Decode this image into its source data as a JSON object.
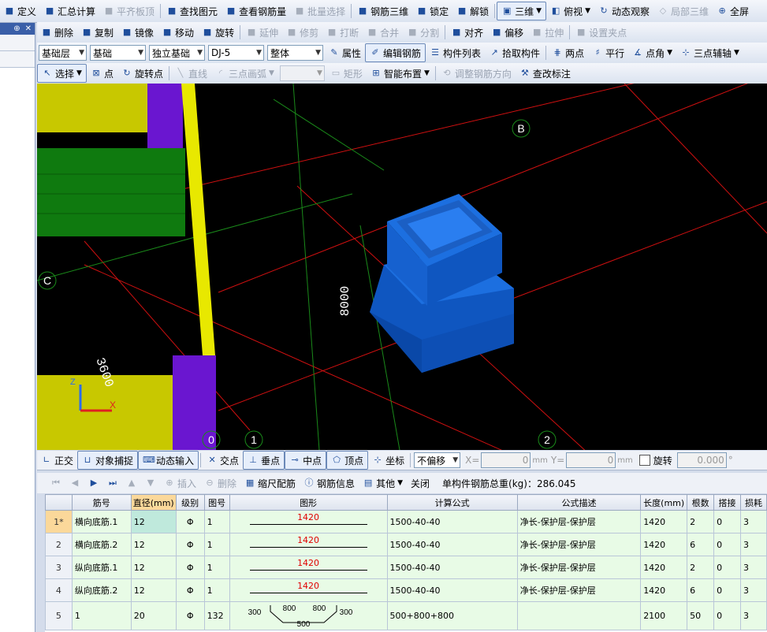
{
  "toolbar1": {
    "items": [
      {
        "label": "定义",
        "icon": "define-icon",
        "disabled": false
      },
      {
        "label": "汇总计算",
        "icon": "sigma-icon",
        "disabled": false
      },
      {
        "label": "平齐板顶",
        "icon": "align-slab-icon",
        "disabled": true
      },
      {
        "label": "查找图元",
        "icon": "find-element-icon",
        "disabled": false
      },
      {
        "label": "查看钢筋量",
        "icon": "rebar-quantity-icon",
        "disabled": false
      },
      {
        "label": "批量选择",
        "icon": "batch-select-icon",
        "disabled": true
      },
      {
        "label": "钢筋三维",
        "icon": "rebar-3d-icon",
        "disabled": false
      },
      {
        "label": "锁定",
        "icon": "lock-icon",
        "disabled": false
      },
      {
        "label": "解锁",
        "icon": "unlock-icon",
        "disabled": false
      }
    ],
    "view3d_label": "三维",
    "topview_label": "俯视",
    "dynamic_view_label": "动态观察",
    "local3d_label": "局部三维",
    "fullscreen_label": "全屏"
  },
  "toolbar2": {
    "items": [
      {
        "label": "删除",
        "icon": "delete-icon",
        "disabled": false
      },
      {
        "label": "复制",
        "icon": "copy-icon",
        "disabled": false
      },
      {
        "label": "镜像",
        "icon": "mirror-icon",
        "disabled": false
      },
      {
        "label": "移动",
        "icon": "move-icon",
        "disabled": false
      },
      {
        "label": "旋转",
        "icon": "rotate-icon",
        "disabled": false
      },
      {
        "label": "延伸",
        "icon": "extend-icon",
        "disabled": true
      },
      {
        "label": "修剪",
        "icon": "trim-icon",
        "disabled": true
      },
      {
        "label": "打断",
        "icon": "break-icon",
        "disabled": true
      },
      {
        "label": "合并",
        "icon": "merge-icon",
        "disabled": true
      },
      {
        "label": "分割",
        "icon": "split-icon",
        "disabled": true
      },
      {
        "label": "对齐",
        "icon": "align-icon",
        "disabled": false
      },
      {
        "label": "偏移",
        "icon": "offset-icon",
        "disabled": false
      },
      {
        "label": "拉伸",
        "icon": "stretch-icon",
        "disabled": true
      },
      {
        "label": "设置夹点",
        "icon": "grip-icon",
        "disabled": true
      }
    ]
  },
  "toolbar3": {
    "floor": "基础层",
    "category": "基础",
    "type": "独立基础",
    "component": "DJ-5",
    "whole": "整体",
    "properties_label": "属性",
    "edit_rebar_label": "编辑钢筋",
    "component_list_label": "构件列表",
    "pick_component_label": "拾取构件",
    "two_points_label": "两点",
    "parallel_label": "平行",
    "point_angle_label": "点角",
    "three_point_aux_label": "三点辅轴"
  },
  "toolbar4": {
    "select_label": "选择",
    "point_label": "点",
    "rotate_point_label": "旋转点",
    "line_label": "直线",
    "arc_label": "三点画弧",
    "rect_label": "矩形",
    "smart_layout_label": "智能布置",
    "adjust_rebar_dir_label": "调整钢筋方向",
    "check_annotation_label": "查改标注"
  },
  "viewport": {
    "axis_labels": [
      "B",
      "C",
      "1",
      "2",
      "0"
    ],
    "dimension_8000": "8000",
    "dimension_3600": "3600",
    "axis_x": "X",
    "axis_z": "Z"
  },
  "snapbar": {
    "ortho_label": "正交",
    "object_snap_label": "对象捕捉",
    "dynamic_input_label": "动态输入",
    "intersection_label": "交点",
    "perpendicular_label": "垂点",
    "midpoint_label": "中点",
    "vertex_label": "顶点",
    "coordinate_label": "坐标",
    "offset_mode": "不偏移",
    "x_label": "X=",
    "x_value": "0",
    "y_label": "Y=",
    "y_value": "0",
    "unit": "mm",
    "rotate_label": "旋转",
    "rotate_value": "0.000",
    "degree": "°"
  },
  "gridtools": {
    "insert_label": "插入",
    "delete_label": "删除",
    "scale_rebar_label": "缩尺配筋",
    "rebar_info_label": "钢筋信息",
    "other_label": "其他",
    "close_label": "关闭",
    "total_label": "单构件钢筋总重(kg)：286.045"
  },
  "table": {
    "headers": [
      "筋号",
      "直径(mm)",
      "级别",
      "图号",
      "图形",
      "计算公式",
      "公式描述",
      "长度(mm)",
      "根数",
      "搭接",
      "损耗"
    ],
    "rows": [
      {
        "num": "1*",
        "name": "横向底筋.1",
        "dia": "12",
        "grade": "Φ",
        "fig": "1",
        "shape": "1420",
        "formula": "1500-40-40",
        "desc": "净长-保护层-保护层",
        "length": "1420",
        "count": "2",
        "lap": "0",
        "loss": "3"
      },
      {
        "num": "2",
        "name": "横向底筋.2",
        "dia": "12",
        "grade": "Φ",
        "fig": "1",
        "shape": "1420",
        "formula": "1500-40-40",
        "desc": "净长-保护层-保护层",
        "length": "1420",
        "count": "6",
        "lap": "0",
        "loss": "3"
      },
      {
        "num": "3",
        "name": "纵向底筋.1",
        "dia": "12",
        "grade": "Φ",
        "fig": "1",
        "shape": "1420",
        "formula": "1500-40-40",
        "desc": "净长-保护层-保护层",
        "length": "1420",
        "count": "2",
        "lap": "0",
        "loss": "3"
      },
      {
        "num": "4",
        "name": "纵向底筋.2",
        "dia": "12",
        "grade": "Φ",
        "fig": "1",
        "shape": "1420",
        "formula": "1500-40-40",
        "desc": "净长-保护层-保护层",
        "length": "1420",
        "count": "6",
        "lap": "0",
        "loss": "3"
      },
      {
        "num": "5",
        "name": "1",
        "dia": "20",
        "grade": "Φ",
        "fig": "132",
        "shape_bent": {
          "a": "300",
          "b": "800",
          "c": "800",
          "d": "300",
          "e": "500"
        },
        "formula": "500+800+800",
        "desc": "",
        "length": "2100",
        "count": "50",
        "lap": "0",
        "loss": "3"
      }
    ]
  },
  "colors": {
    "viewport_bg": "#000000",
    "component_blue": "#1c6fe0",
    "grid_red": "#d01010",
    "grid_green": "#1a8a1a",
    "column_yellow": "#c8c800",
    "beam_green": "#0f7a0f",
    "column_purple": "#6a16d0",
    "table_row_bg": "#e8fbe6",
    "selected_header": "#fbd89a"
  }
}
